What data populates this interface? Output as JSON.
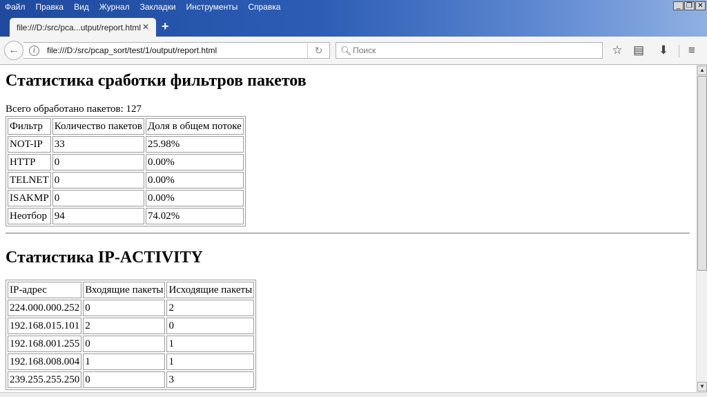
{
  "menu": [
    "Файл",
    "Правка",
    "Вид",
    "Журнал",
    "Закладки",
    "Инструменты",
    "Справка"
  ],
  "window_controls": {
    "minimize": "_",
    "restore": "❐",
    "close": "✕"
  },
  "tab": {
    "title": "file:///D:/src/pca...utput/report.html",
    "close": "✕"
  },
  "new_tab": "+",
  "nav": {
    "url": "file:///D:/src/pcap_sort/test/1/output/report.html",
    "search_placeholder": "Поиск",
    "icons": [
      "back-icon",
      "info-icon",
      "reload-icon",
      "search-icon",
      "bookmark-star-icon",
      "reading-list-icon",
      "downloads-icon",
      "menu-icon"
    ]
  },
  "page": {
    "heading1": "Статистика сработки фильтров пакетов",
    "total": "Всего обработано пакетов: 127",
    "filter_table": {
      "headers": [
        "Фильтр",
        "Количество пакетов",
        "Доля в общем потоке"
      ],
      "rows": [
        [
          "NOT-IP",
          "33",
          "25.98%"
        ],
        [
          "HTTP",
          "0",
          "0.00%"
        ],
        [
          "TELNET",
          "0",
          "0.00%"
        ],
        [
          "ISAKMP",
          "0",
          "0.00%"
        ],
        [
          "Неотбор",
          "94",
          "74.02%"
        ]
      ]
    },
    "heading2": "Статистика IP-ACTIVITY",
    "ip_table": {
      "headers": [
        "IP-адрес",
        "Входящие пакеты",
        "Исходящие пакеты"
      ],
      "rows": [
        [
          "224.000.000.252",
          "0",
          "2"
        ],
        [
          "192.168.015.101",
          "2",
          "0"
        ],
        [
          "192.168.001.255",
          "0",
          "1"
        ],
        [
          "192.168.008.004",
          "1",
          "1"
        ],
        [
          "239.255.255.250",
          "0",
          "3"
        ]
      ]
    }
  }
}
